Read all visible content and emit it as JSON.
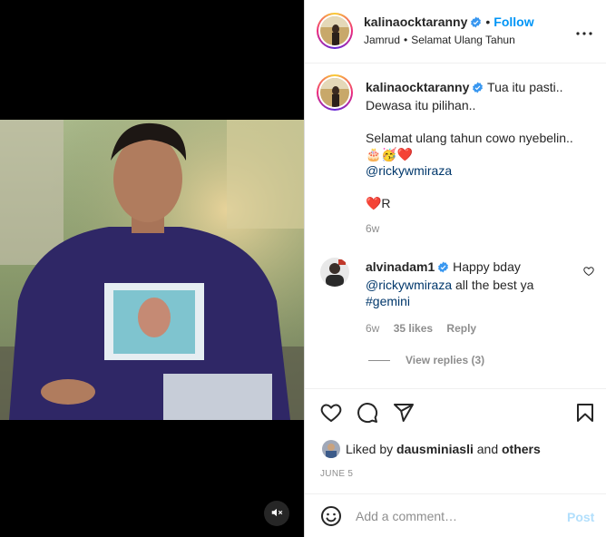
{
  "post": {
    "author": "kalinaocktaranny",
    "follow_label": "Follow",
    "location": "Jamrud",
    "audio": "Selamat Ulang Tahun",
    "separator": "•"
  },
  "caption": {
    "author": "kalinaocktaranny",
    "line1": "Tua itu pasti..",
    "line2": "Dewasa itu pilihan..",
    "line3": "Selamat ulang tahun cowo nyebelin..",
    "emojis": "🎂🥳❤️",
    "mention": "@rickywmiraza",
    "signoff": "❤️R",
    "age": "6w"
  },
  "comment": {
    "author": "alvinadam1",
    "text_before": "Happy bday",
    "mention": "@rickywmiraza",
    "text_after": " all the best ya",
    "hashtag": "#gemini",
    "age": "6w",
    "likes": "35 likes",
    "reply_label": "Reply",
    "view_replies": "View replies (3)"
  },
  "engagement": {
    "liked_by_prefix": "Liked by ",
    "liked_by_user": "dausminiasli",
    "liked_by_and": " and ",
    "liked_by_others": "others",
    "date": "JUNE 5"
  },
  "composer": {
    "placeholder": "Add a comment…",
    "post_label": "Post"
  },
  "colors": {
    "accent": "#0095f6",
    "verified": "#3897f0",
    "mention": "#00376b",
    "muted": "#8e8e8e",
    "post_disabled": "#b2dffc"
  },
  "icons": {
    "verified": "verified-badge-icon",
    "more": "more-options-icon",
    "like": "heart-icon",
    "comment": "comment-bubble-icon",
    "share": "paper-plane-icon",
    "save": "bookmark-icon",
    "emoji": "smiley-icon",
    "mute": "speaker-muted-icon"
  }
}
